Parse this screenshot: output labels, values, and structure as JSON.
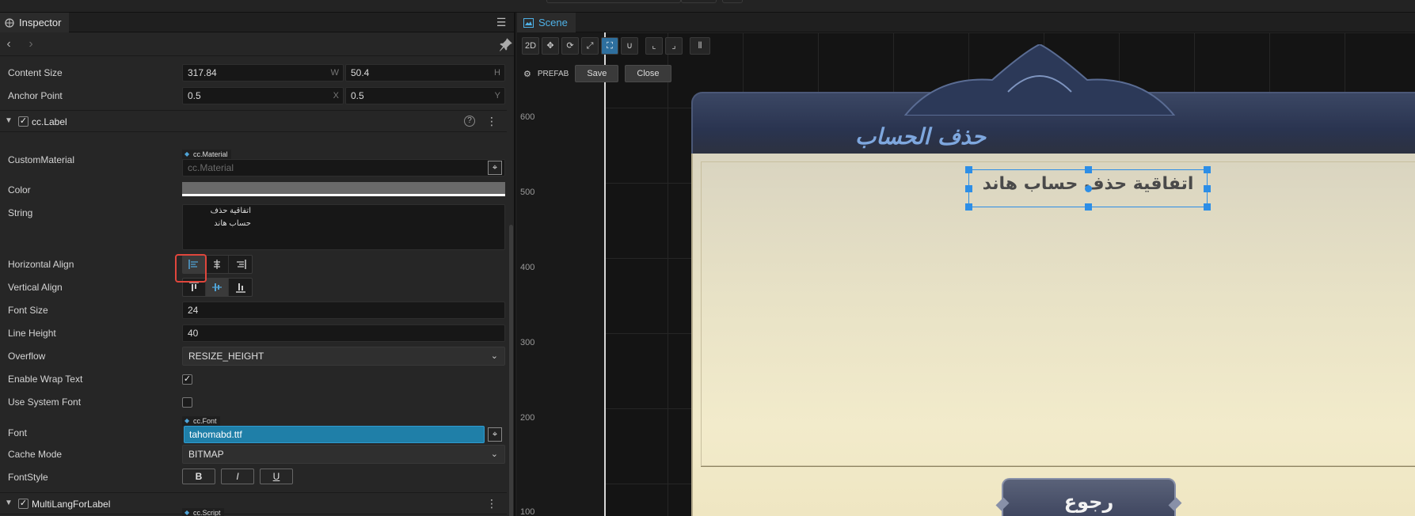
{
  "inspector": {
    "tab_label": "Inspector",
    "properties": {
      "content_size": {
        "label": "Content Size",
        "width": "317.84",
        "width_unit": "W",
        "height": "50.4",
        "height_unit": "H"
      },
      "anchor_point": {
        "label": "Anchor Point",
        "x": "0.5",
        "x_unit": "X",
        "y": "0.5",
        "y_unit": "Y"
      }
    },
    "label_component": {
      "title": "cc.Label",
      "enabled": true,
      "custom_material": {
        "label": "CustomMaterial",
        "type_tag": "cc.Material",
        "value": "cc.Material"
      },
      "color": {
        "label": "Color",
        "swatch": "#6a6a6a"
      },
      "string": {
        "label": "String",
        "value": "اتفاقية حذف حساب هاند"
      },
      "horizontal_align": {
        "label": "Horizontal Align",
        "selected": "left"
      },
      "vertical_align": {
        "label": "Vertical Align",
        "selected": "center"
      },
      "font_size": {
        "label": "Font Size",
        "value": "24"
      },
      "line_height": {
        "label": "Line Height",
        "value": "40"
      },
      "overflow": {
        "label": "Overflow",
        "value": "RESIZE_HEIGHT"
      },
      "enable_wrap_text": {
        "label": "Enable Wrap Text",
        "checked": true
      },
      "use_system_font": {
        "label": "Use System Font",
        "checked": false
      },
      "font": {
        "label": "Font",
        "type_tag": "cc.Font",
        "value": "tahomabd.ttf"
      },
      "cache_mode": {
        "label": "Cache Mode",
        "value": "BITMAP"
      },
      "font_style": {
        "label": "FontStyle",
        "bold": "B",
        "italic": "I",
        "underline": "U"
      }
    },
    "multilang_component": {
      "title": "MultiLangForLabel",
      "enabled": true,
      "script_tag": "cc.Script"
    }
  },
  "scene": {
    "tab_label": "Scene",
    "toolbar": {
      "mode_2d": "2D",
      "tools": [
        "move-icon",
        "rotate-icon",
        "scale-icon",
        "rect-icon",
        "snap-icon",
        "align-anchor-icon",
        "align-pivot-icon",
        "distribute-icon"
      ]
    },
    "prefab": {
      "label": "PREFAB",
      "save": "Save",
      "close": "Close"
    },
    "ruler_ticks": [
      "600",
      "500",
      "400",
      "300",
      "200",
      "100"
    ],
    "dialog": {
      "title": "حذف الحساب",
      "label_text": "اتفاقية حذف حساب هاند",
      "back_button": "رجوع"
    }
  },
  "colors": {
    "accent": "#2d8ee6",
    "font_field_bg": "#1f7fa8",
    "highlight": "#e0463c",
    "dialog_title": "#7ea7de"
  }
}
